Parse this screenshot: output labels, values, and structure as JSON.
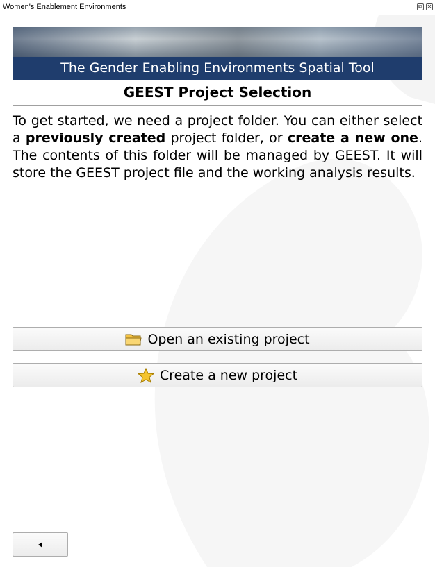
{
  "window": {
    "title": "Women's Enablement Environments"
  },
  "banner": {
    "text": "The Gender Enabling Environments Spatial Tool"
  },
  "heading": "GEEST Project Selection",
  "intro": {
    "part1": "To get started, we need a project folder. You can either select a ",
    "bold1": "previously created",
    "part2": " project folder, or ",
    "bold2": "create a new one",
    "part3": ". The contents of this folder will be managed by GEEST. It will store the GEEST project file and the working analysis results."
  },
  "buttons": {
    "open_existing": "Open an existing project",
    "create_new": "Create a new project"
  },
  "colors": {
    "banner_strip": "#1f3d6d",
    "folder_icon": "#f5c242",
    "star_icon": "#f4c430"
  },
  "icons": {
    "open_existing": "folder-icon",
    "create_new": "star-icon",
    "back": "triangle-left-icon"
  }
}
